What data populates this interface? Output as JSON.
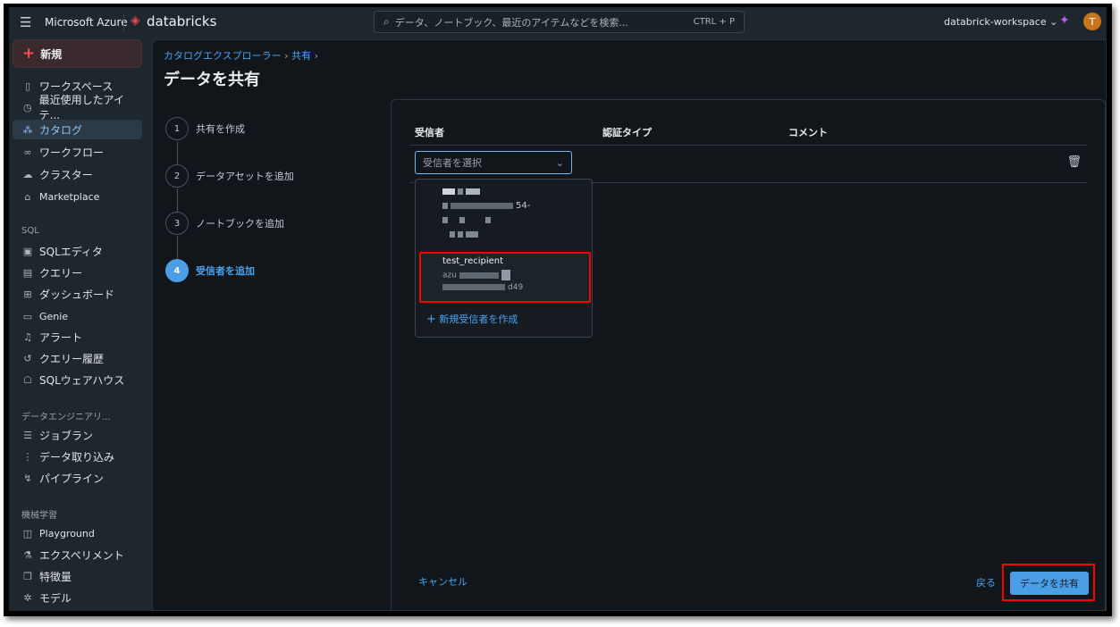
{
  "topbar": {
    "menu_icon": "hamburger-icon",
    "brand": "Microsoft Azure",
    "product": "databricks",
    "search_placeholder": "データ、ノートブック、最近のアイテムなどを検索...",
    "search_shortcut": "CTRL + P",
    "workspace": "databrick-workspace",
    "avatar_initial": "T"
  },
  "sidebar": {
    "new_label": "新規",
    "items": [
      {
        "label": "ワークスペース",
        "icon": "notebook-icon"
      },
      {
        "label": "最近使用したアイテ...",
        "icon": "clock-icon"
      },
      {
        "label": "カタログ",
        "icon": "catalog-icon",
        "active": true
      },
      {
        "label": "ワークフロー",
        "icon": "workflow-icon"
      },
      {
        "label": "クラスター",
        "icon": "cloud-icon"
      },
      {
        "label": "Marketplace",
        "icon": "store-icon"
      }
    ],
    "sql_section": "SQL",
    "sql_items": [
      {
        "label": "SQLエディタ"
      },
      {
        "label": "クエリー"
      },
      {
        "label": "ダッシュボード"
      },
      {
        "label": "Genie"
      },
      {
        "label": "アラート"
      },
      {
        "label": "クエリー履歴"
      },
      {
        "label": "SQLウェアハウス"
      }
    ],
    "de_section": "データエンジニアリ...",
    "de_items": [
      {
        "label": "ジョブラン"
      },
      {
        "label": "データ取り込み"
      },
      {
        "label": "パイプライン"
      }
    ],
    "ml_section": "機械学習",
    "ml_items": [
      {
        "label": "Playground"
      },
      {
        "label": "エクスペリメント"
      },
      {
        "label": "特徴量"
      },
      {
        "label": "モデル"
      }
    ]
  },
  "breadcrumb": {
    "items": [
      "カタログエクスプローラー",
      "共有"
    ],
    "sep": "›"
  },
  "page_title": "データを共有",
  "steps": [
    {
      "n": "1",
      "label": "共有を作成"
    },
    {
      "n": "2",
      "label": "データアセットを追加"
    },
    {
      "n": "3",
      "label": "ノートブックを追加"
    },
    {
      "n": "4",
      "label": "受信者を追加",
      "active": true
    }
  ],
  "table": {
    "headers": [
      "受信者",
      "認証タイプ",
      "コメント"
    ],
    "select_placeholder": "受信者を選択"
  },
  "dropdown": {
    "option1_fragment": "54-",
    "option2_name": "test_recipient",
    "option2_line1": "azu",
    "option2_line2_fragment": "d49",
    "create_label": "新規受信者を作成"
  },
  "footer": {
    "cancel": "キャンセル",
    "back": "戻る",
    "submit": "データを共有"
  },
  "colors": {
    "accent": "#4aa3f0",
    "highlight": "#ff0000",
    "primary_button": "#4b9ee6"
  }
}
